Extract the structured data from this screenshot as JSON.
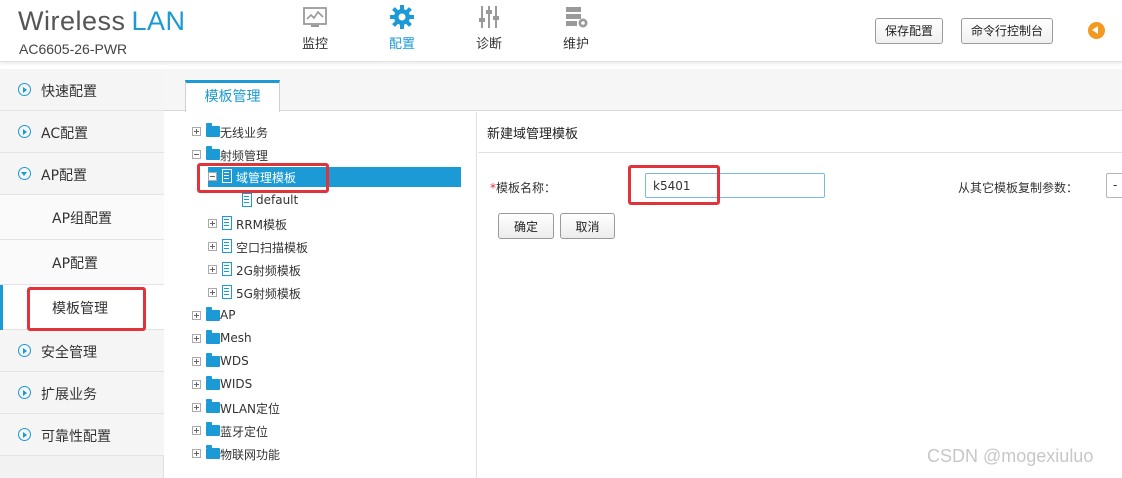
{
  "app": {
    "title": "Wireless",
    "title_accent": "LAN",
    "model": "AC6605-26-PWR",
    "accent_color": "#1b9ad6"
  },
  "nav": [
    {
      "label": "监控",
      "icon": "monitor-icon"
    },
    {
      "label": "配置",
      "icon": "gear-icon",
      "active": true
    },
    {
      "label": "诊断",
      "icon": "sliders-icon"
    },
    {
      "label": "维护",
      "icon": "server-gear-icon"
    }
  ],
  "header_buttons": {
    "save": "保存配置",
    "cli": "命令行控制台"
  },
  "sidebar": {
    "items": [
      {
        "label": "快速配置"
      },
      {
        "label": "AC配置"
      },
      {
        "label": "AP配置",
        "expanded": true
      },
      {
        "label": "安全管理"
      },
      {
        "label": "扩展业务"
      },
      {
        "label": "可靠性配置"
      }
    ],
    "subitems": [
      {
        "label": "AP组配置"
      },
      {
        "label": "AP配置"
      },
      {
        "label": "模板管理",
        "active": true
      }
    ]
  },
  "tabs": [
    {
      "label": "模板管理",
      "active": true
    }
  ],
  "tree": {
    "nodes": [
      {
        "label": "无线业务",
        "icon": "folder-icon",
        "toggle": "plus"
      },
      {
        "label": "射频管理",
        "icon": "folder-icon",
        "toggle": "minus"
      },
      {
        "label": "域管理模板",
        "icon": "document-icon",
        "toggle": "minus",
        "selected": true
      },
      {
        "label": "default",
        "icon": "document-icon"
      },
      {
        "label": "RRM模板",
        "icon": "document-icon",
        "toggle": "plus"
      },
      {
        "label": "空口扫描模板",
        "icon": "document-icon",
        "toggle": "plus"
      },
      {
        "label": "2G射频模板",
        "icon": "document-icon",
        "toggle": "plus"
      },
      {
        "label": "5G射频模板",
        "icon": "document-icon",
        "toggle": "plus"
      },
      {
        "label": "AP",
        "icon": "folder-icon",
        "toggle": "plus"
      },
      {
        "label": "Mesh",
        "icon": "folder-icon",
        "toggle": "plus"
      },
      {
        "label": "WDS",
        "icon": "folder-icon",
        "toggle": "plus"
      },
      {
        "label": "WIDS",
        "icon": "folder-icon",
        "toggle": "plus"
      },
      {
        "label": "WLAN定位",
        "icon": "folder-icon",
        "toggle": "plus"
      },
      {
        "label": "蓝牙定位",
        "icon": "folder-icon",
        "toggle": "plus"
      },
      {
        "label": "物联网功能",
        "icon": "folder-icon",
        "toggle": "plus"
      }
    ]
  },
  "form": {
    "title": "新建域管理模板",
    "required_mark": "*",
    "name_label": "模板名称：",
    "name_value": "k5401",
    "copy_label": "从其它模板复制参数：",
    "copy_select": "-",
    "ok": "确定",
    "cancel": "取消"
  },
  "watermark": "CSDN @mogexiuluo"
}
